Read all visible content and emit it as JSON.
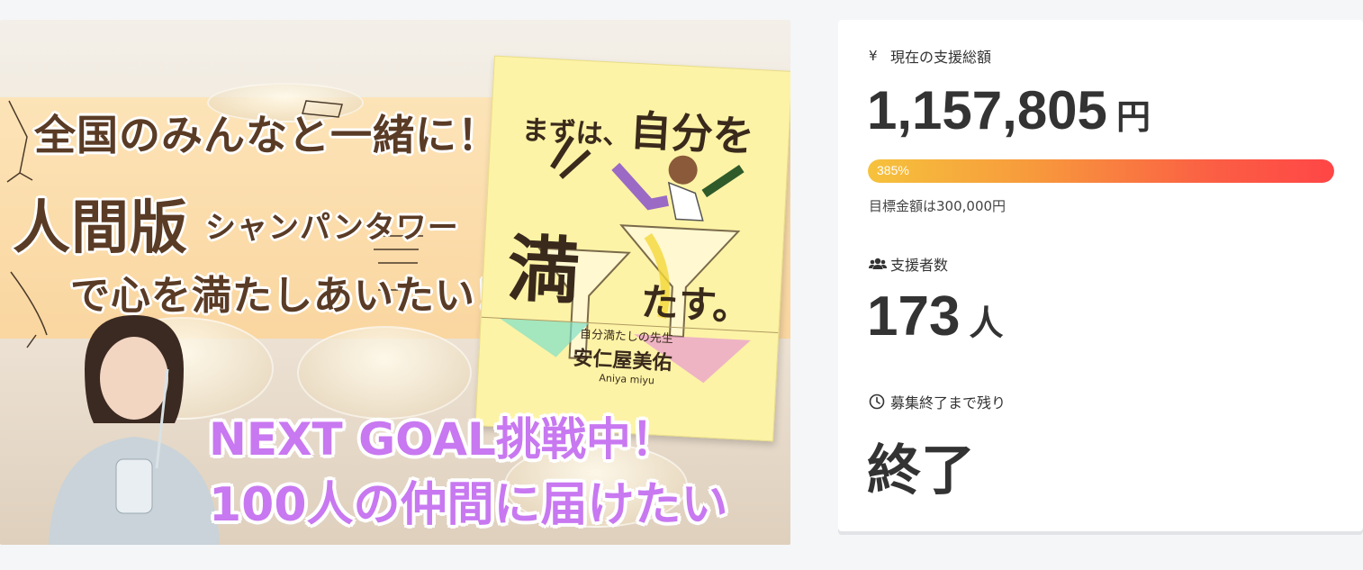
{
  "hero": {
    "headline_1": "全国のみんなと一緒に！",
    "headline_2": "人間版",
    "headline_3": "シャンパンタワー",
    "headline_4": "で心を満たしあいたい！",
    "goal_1": "NEXT GOAL挑戦中！",
    "goal_2": "100人の仲間に届けたい",
    "book": {
      "title_a": "まずは、",
      "title_b": "自分を",
      "title_big": "満",
      "title_c": "たす。",
      "subtitle": "自分満たしの先生",
      "author": "安仁屋美佑",
      "author_roman": "Aniya miyu"
    }
  },
  "stats": {
    "amount": {
      "icon": "yen-icon",
      "label": "現在の支援総額",
      "value": "1,157,805",
      "unit": "円"
    },
    "progress": {
      "percent_label": "385%",
      "fill_fraction": 1.0,
      "target_text": "目標金額は300,000円"
    },
    "supporters": {
      "icon": "users-icon",
      "label": "支援者数",
      "value": "173",
      "unit": "人"
    },
    "remaining": {
      "icon": "clock-icon",
      "label": "募集終了まで残り",
      "value": "終了"
    }
  },
  "colors": {
    "progress_start": "#f6c23c",
    "progress_end": "#ff4646",
    "goal_text": "#c878f0",
    "headline_text": "#5a3b25"
  }
}
